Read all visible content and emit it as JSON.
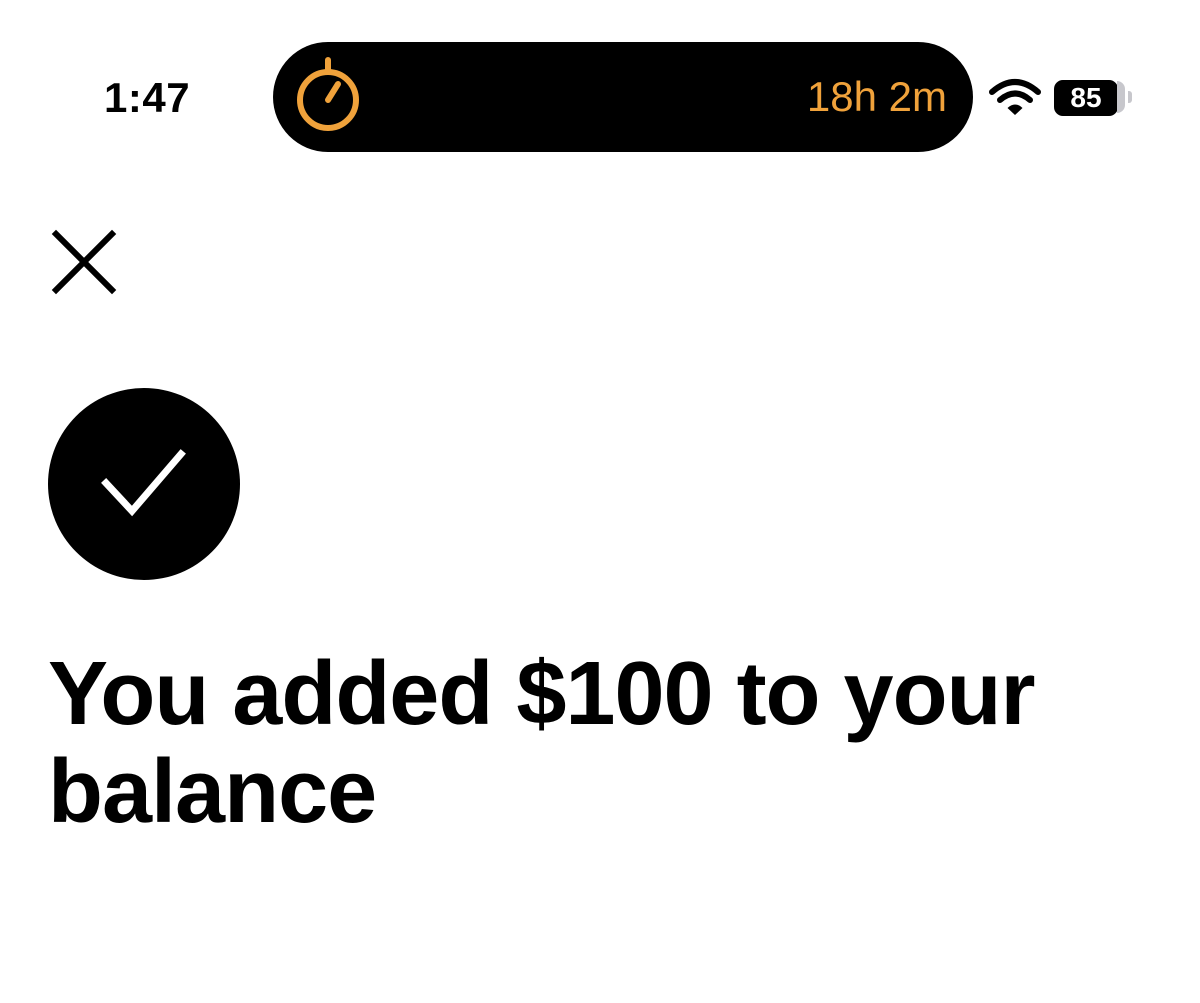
{
  "status_bar": {
    "time": "1:47",
    "battery_level": "85",
    "wifi_icon": "wifi-icon"
  },
  "dynamic_island": {
    "icon": "stopwatch-icon",
    "timer_text": "18h 2m",
    "accent_color": "#F0A23B"
  },
  "header": {
    "close_icon": "close-icon"
  },
  "confirmation": {
    "icon": "checkmark-icon",
    "message": "You added $100 to your balance"
  }
}
